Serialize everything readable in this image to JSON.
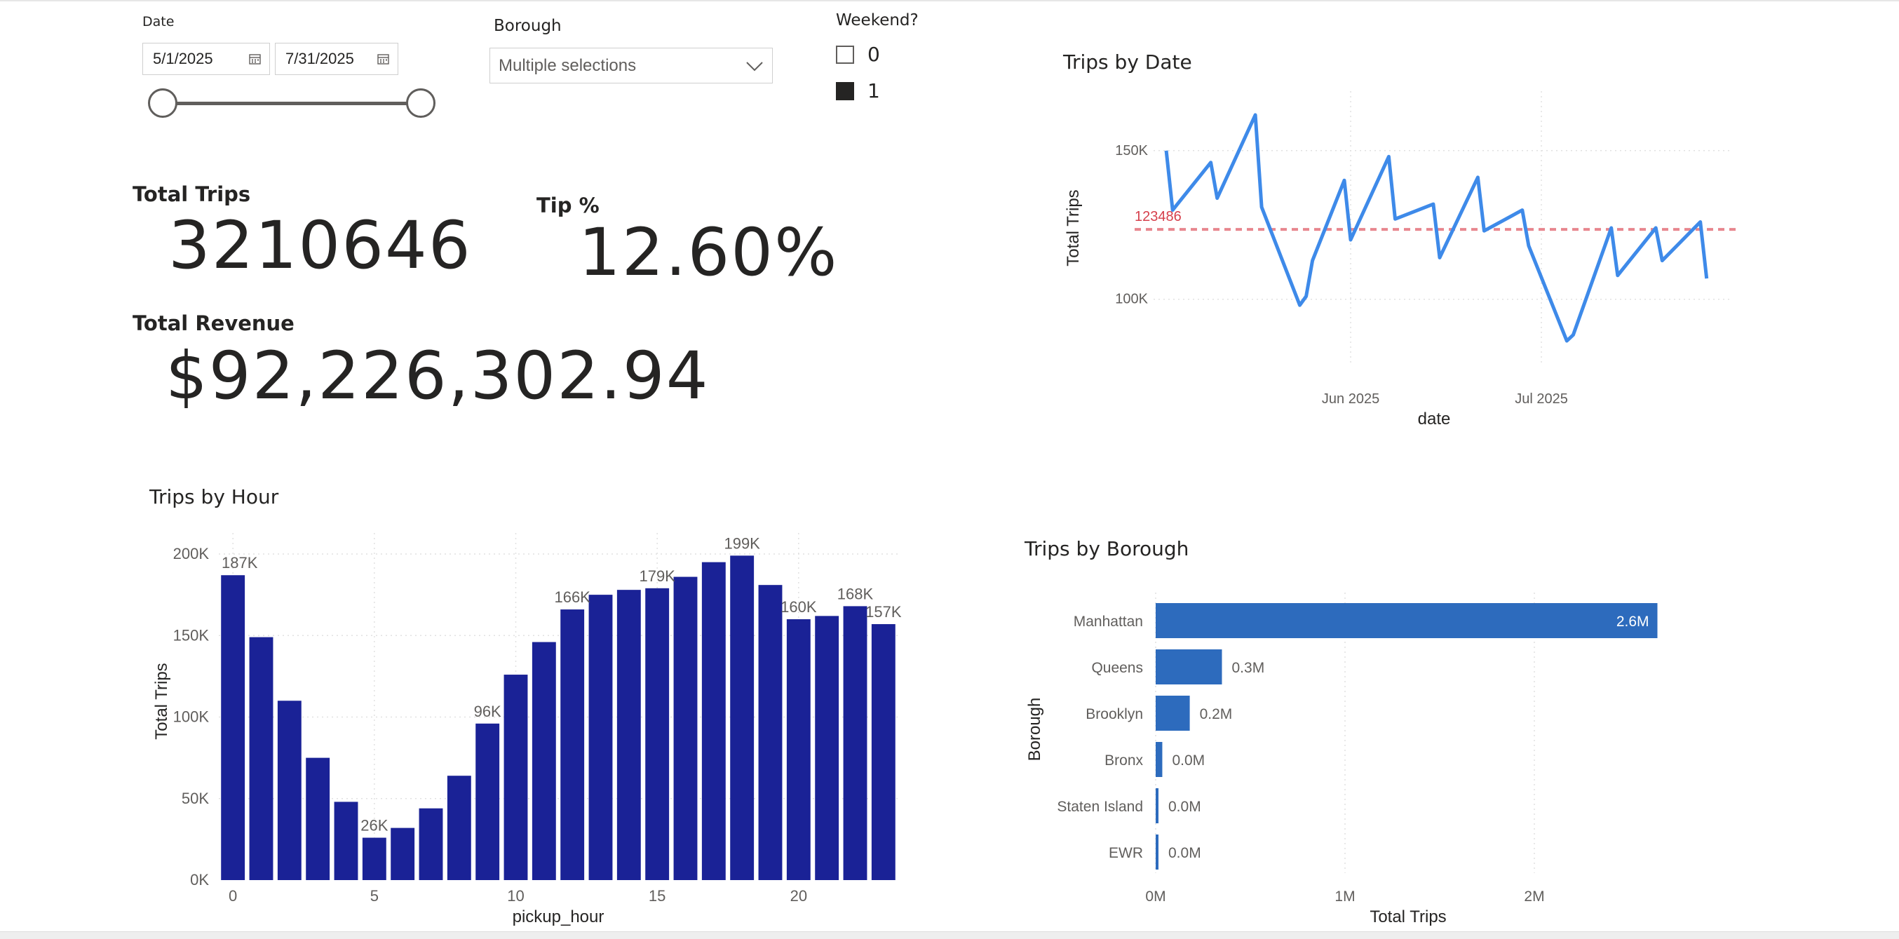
{
  "slicers": {
    "date": {
      "title": "Date",
      "start": "5/1/2025",
      "end": "7/31/2025",
      "icon": "calendar-icon",
      "range_fraction": [
        0,
        1
      ]
    },
    "borough": {
      "title": "Borough",
      "selected": "Multiple selections",
      "icon": "chevron-down-icon"
    },
    "weekend": {
      "title": "Weekend?",
      "options": [
        {
          "label": "0",
          "checked": false
        },
        {
          "label": "1",
          "checked": true
        }
      ]
    }
  },
  "cards": {
    "total_trips": {
      "label": "Total Trips",
      "value": "3210646"
    },
    "tip_pct": {
      "label": "Tip %",
      "value": "12.60%"
    },
    "total_revenue": {
      "label": "Total Revenue",
      "value": "$92,226,302.94"
    }
  },
  "colors": {
    "line": "#3e8ae9",
    "reference_line": "#e8868e",
    "reference_label": "#d6404c",
    "hour_bars": "#1a2296",
    "borough_bars": "#2d6bbd"
  },
  "chart_data": [
    {
      "type": "line",
      "title": "Trips by Date",
      "xlabel": "date",
      "ylabel": "Total Trips",
      "x": [
        "2025-05-03",
        "2025-05-04",
        "2025-05-10",
        "2025-05-11",
        "2025-05-17",
        "2025-05-18",
        "2025-05-24",
        "2025-05-25",
        "2025-05-26",
        "2025-05-31",
        "2025-06-01",
        "2025-06-07",
        "2025-06-08",
        "2025-06-14",
        "2025-06-15",
        "2025-06-21",
        "2025-06-22",
        "2025-06-28",
        "2025-06-29",
        "2025-07-05",
        "2025-07-06",
        "2025-07-12",
        "2025-07-13",
        "2025-07-19",
        "2025-07-20",
        "2025-07-26",
        "2025-07-27"
      ],
      "series": [
        {
          "values": [
            150000,
            130000,
            146000,
            134000,
            162000,
            131000,
            98000,
            101000,
            113000,
            140000,
            120000,
            148000,
            127000,
            132000,
            114000,
            141000,
            123000,
            130000,
            118000,
            86000,
            88000,
            124000,
            108000,
            124000,
            113000,
            126000,
            107000
          ]
        }
      ],
      "reference_line": {
        "value": 123486,
        "label": "123486"
      },
      "y_ticks": [
        "100K",
        "150K"
      ],
      "x_ticks": [
        "Jun 2025",
        "Jul 2025"
      ],
      "ylim": [
        78000,
        170000
      ],
      "grid": true
    },
    {
      "type": "bar",
      "title": "Trips by Hour",
      "xlabel": "pickup_hour",
      "ylabel": "Total Trips",
      "categories": [
        0,
        1,
        2,
        3,
        4,
        5,
        6,
        7,
        8,
        9,
        10,
        11,
        12,
        13,
        14,
        15,
        16,
        17,
        18,
        19,
        20,
        21,
        22,
        23
      ],
      "values": [
        187000,
        149000,
        110000,
        75000,
        48000,
        26000,
        32000,
        44000,
        64000,
        96000,
        126000,
        146000,
        166000,
        175000,
        178000,
        179000,
        186000,
        195000,
        199000,
        181000,
        160000,
        162000,
        168000,
        157000
      ],
      "data_labels": {
        "0": "187K",
        "5": "26K",
        "9": "96K",
        "12": "166K",
        "15": "179K",
        "18": "199K",
        "20": "160K",
        "22": "168K",
        "23": "157K"
      },
      "y_ticks": [
        "0K",
        "50K",
        "100K",
        "150K",
        "200K"
      ],
      "x_ticks": [
        "0",
        "5",
        "10",
        "15",
        "20"
      ],
      "ylim": [
        0,
        200000
      ],
      "grid": true
    },
    {
      "type": "bar",
      "orientation": "horizontal",
      "title": "Trips by Borough",
      "xlabel": "Total Trips",
      "ylabel": "Borough",
      "categories": [
        "Manhattan",
        "Queens",
        "Brooklyn",
        "Bronx",
        "Staten Island",
        "EWR"
      ],
      "values": [
        2650000,
        350000,
        180000,
        35000,
        8000,
        5000
      ],
      "data_labels": [
        "2.6M",
        "0.3M",
        "0.2M",
        "0.0M",
        "0.0M",
        "0.0M"
      ],
      "x_ticks": [
        "0M",
        "1M",
        "2M"
      ],
      "xlim": [
        0,
        2800000
      ],
      "grid": true
    }
  ]
}
